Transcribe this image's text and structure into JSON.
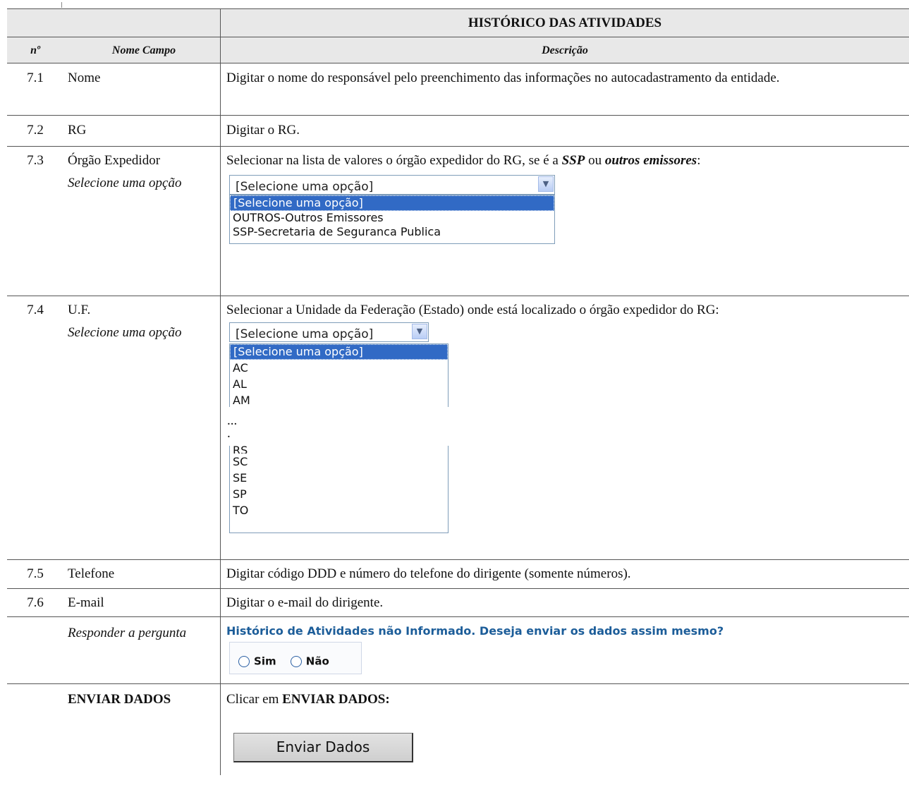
{
  "header": {
    "title": "HISTÓRICO DAS ATIVIDADES",
    "col_num": "nº",
    "col_field": "Nome Campo",
    "col_desc": "Descrição"
  },
  "rows": {
    "r71": {
      "num": "7.1",
      "field": "Nome",
      "desc": "Digitar o nome do responsável pelo preenchimento das informações no autocadastramento da entidade."
    },
    "r72": {
      "num": "7.2",
      "field": "RG",
      "desc": "Digitar o RG."
    },
    "r73": {
      "num": "7.3",
      "field": "Órgão Expedidor",
      "subfield": "Selecione uma opção",
      "desc_prefix": "Selecionar na lista de valores o órgão expedidor do RG, se é a ",
      "desc_b1": "SSP",
      "desc_mid": " ou ",
      "desc_b2": "outros emissores",
      "desc_suffix": ":"
    },
    "r74": {
      "num": "7.4",
      "field": "U.F.",
      "subfield": "Selecione uma opção",
      "desc": "Selecionar a Unidade da Federação (Estado) onde está localizado o órgão expedidor do RG:"
    },
    "r75": {
      "num": "7.5",
      "field": "Telefone",
      "desc": "Digitar código DDD e número do telefone do dirigente (somente números)."
    },
    "r76": {
      "num": "7.6",
      "field": "E-mail",
      "desc": "Digitar o e-mail do dirigente."
    },
    "r77": {
      "field": "Responder a pergunta"
    },
    "r78": {
      "field": "ENVIAR DADOS",
      "desc_prefix": "Clicar em ",
      "desc_bold": "ENVIAR DADOS:"
    }
  },
  "orgao_select": {
    "value": "[Selecione uma opção]",
    "options": [
      "[Selecione uma opção]",
      "OUTROS-Outros Emissores",
      "SSP-Secretaria de Seguranca Publica"
    ]
  },
  "uf_select": {
    "value": "[Selecione uma opção]",
    "options_top": [
      "[Selecione uma opção]",
      "AC",
      "AL",
      "AM"
    ],
    "ellipsis": "...",
    "dot": ".",
    "options_bottom": [
      "RS",
      "SC",
      "SE",
      "SP",
      "TO"
    ]
  },
  "question": {
    "text": "Histórico de Atividades não Informado. Deseja enviar os dados assim mesmo?",
    "yes": "Sim",
    "no": "Não"
  },
  "submit": {
    "label": "Enviar Dados"
  },
  "colors": {
    "header_bg": "#e8e8e8",
    "selected_option": "#316ac5",
    "question_text": "#1c5d99"
  }
}
